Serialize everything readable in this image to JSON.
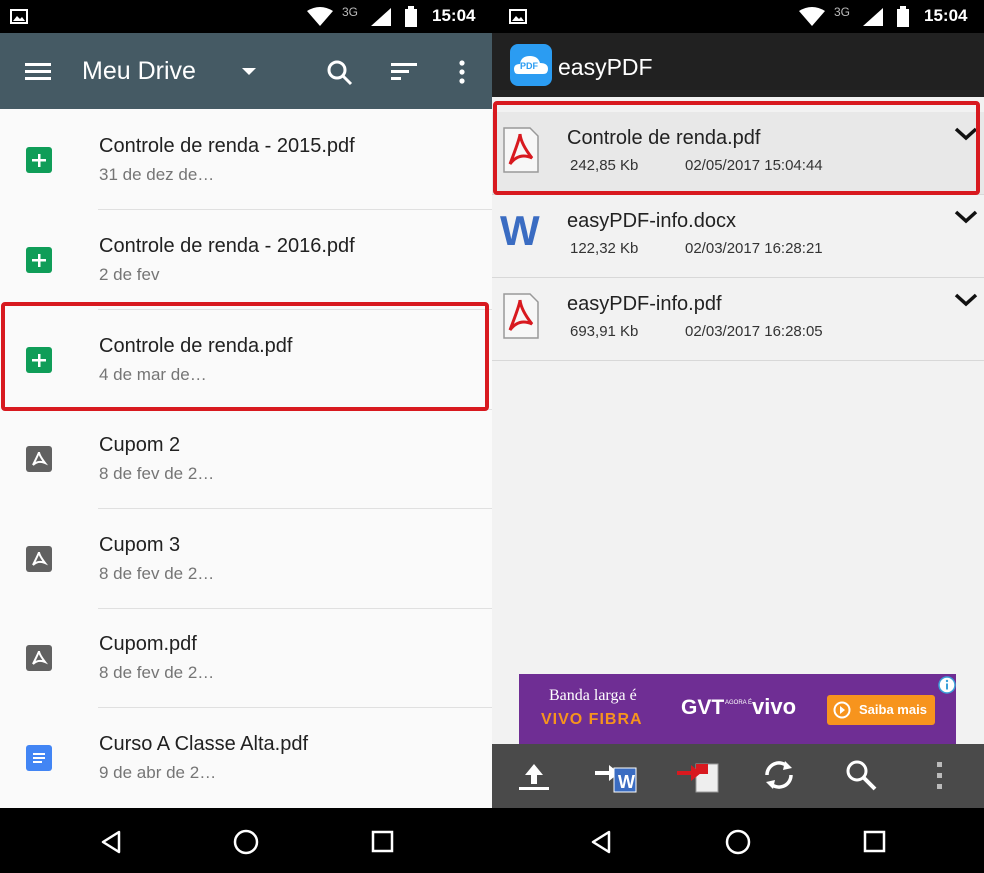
{
  "status": {
    "left_time": "15:04",
    "right_time": "15:04",
    "network": "3G"
  },
  "drive": {
    "title": "Meu Drive",
    "files": [
      {
        "name": "Controle de renda - 2015.pdf",
        "date": "31 de dez de…",
        "icon": "sheets-icon"
      },
      {
        "name": "Controle de renda - 2016.pdf",
        "date": "2 de fev",
        "icon": "sheets-icon"
      },
      {
        "name": "Controle de renda.pdf",
        "date": "4 de mar de…",
        "icon": "sheets-icon"
      },
      {
        "name": "Cupom 2",
        "date": "8 de fev de 2…",
        "icon": "pdf-icon"
      },
      {
        "name": "Cupom 3",
        "date": "8 de fev de 2…",
        "icon": "pdf-icon"
      },
      {
        "name": "Cupom.pdf",
        "date": "8 de fev de 2…",
        "icon": "pdf-icon"
      },
      {
        "name": "Curso A Classe Alta.pdf",
        "date": "9 de abr de 2…",
        "icon": "docs-icon"
      }
    ]
  },
  "easypdf": {
    "title": "easyPDF",
    "logo_text": "PDF",
    "files": [
      {
        "name": "Controle de renda.pdf",
        "size": "242,85 Kb",
        "date": "02/05/2017 15:04:44",
        "icon": "acrobat-icon"
      },
      {
        "name": "easyPDF-info.docx",
        "size": "122,32 Kb",
        "date": "02/03/2017 16:28:21",
        "icon": "word-icon"
      },
      {
        "name": "easyPDF-info.pdf",
        "size": "693,91 Kb",
        "date": "02/03/2017 16:28:05",
        "icon": "acrobat-icon"
      }
    ],
    "ad": {
      "line1": "Banda larga é",
      "line2": "VIVO FIBRA",
      "brand1": "GVT",
      "brand_small": "AGORA É",
      "brand2": "vivo",
      "cta": "Saiba mais"
    }
  },
  "colors": {
    "drive_bar": "#455a64",
    "sheets": "#0f9d58",
    "docs": "#4285f4",
    "highlight": "#d8191f",
    "easypdf_bar": "#212121",
    "ad_bg": "#6f2e94",
    "ad_cta": "#f7941d"
  }
}
